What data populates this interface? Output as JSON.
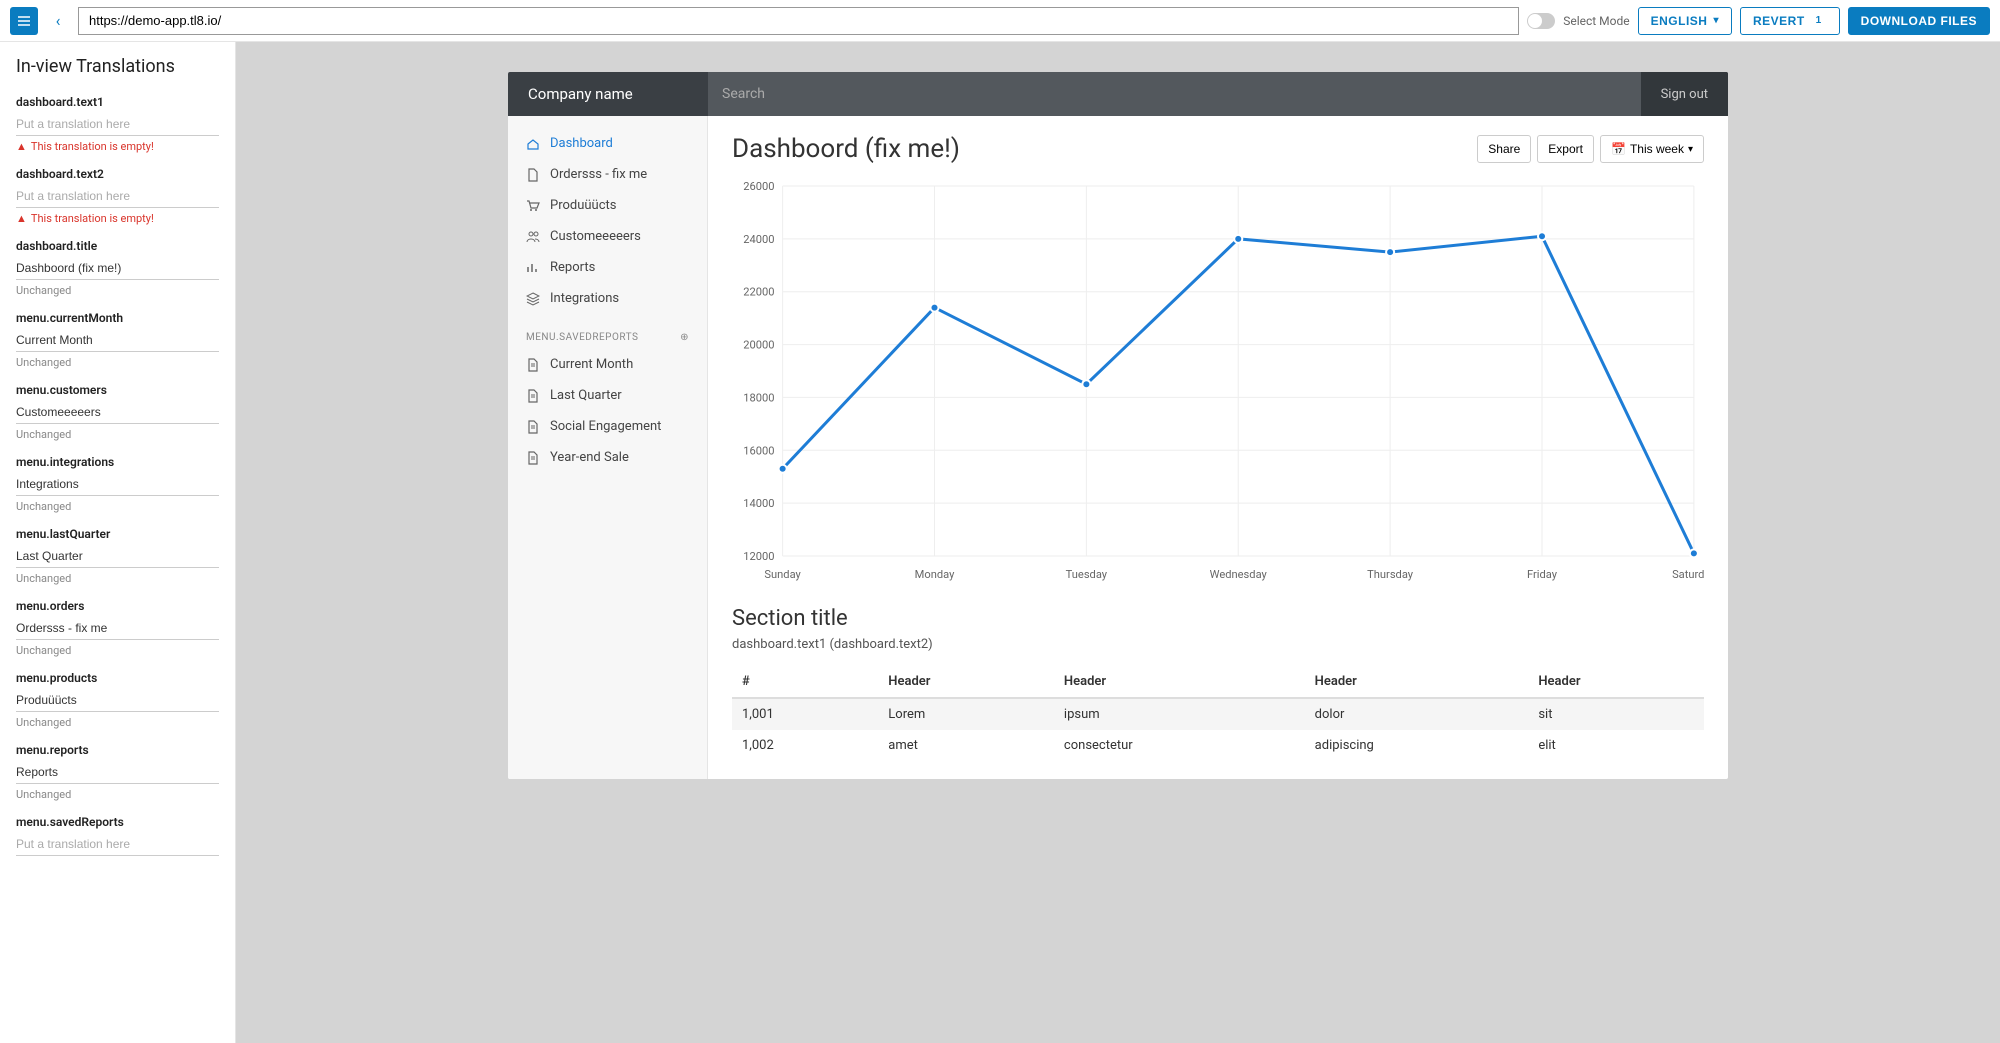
{
  "toolbar": {
    "url": "https://demo-app.tl8.io/",
    "select_mode_label": "Select Mode",
    "language_label": "ENGLISH",
    "revert_label": "REVERT",
    "revert_count": "1",
    "download_label": "DOWNLOAD FILES"
  },
  "sidebar": {
    "title": "In-view Translations",
    "placeholder_text": "Put a translation here",
    "error_text": "This translation is empty!",
    "unchanged_text": "Unchanged",
    "items": [
      {
        "key": "dashboard.text1",
        "value": "",
        "status": "error"
      },
      {
        "key": "dashboard.text2",
        "value": "",
        "status": "error"
      },
      {
        "key": "dashboard.title",
        "value": "Dashboord (fix me!)",
        "status": "unchanged"
      },
      {
        "key": "menu.currentMonth",
        "value": "Current Month",
        "status": "unchanged"
      },
      {
        "key": "menu.customers",
        "value": "Customeeeeers",
        "status": "unchanged"
      },
      {
        "key": "menu.integrations",
        "value": "Integrations",
        "status": "unchanged"
      },
      {
        "key": "menu.lastQuarter",
        "value": "Last Quarter",
        "status": "unchanged"
      },
      {
        "key": "menu.orders",
        "value": "Ordersss - fix me",
        "status": "unchanged"
      },
      {
        "key": "menu.products",
        "value": "Produüücts",
        "status": "unchanged"
      },
      {
        "key": "menu.reports",
        "value": "Reports",
        "status": "unchanged"
      },
      {
        "key": "menu.savedReports",
        "value": "",
        "status": "none"
      }
    ]
  },
  "app": {
    "company": "Company name",
    "search_placeholder": "Search",
    "sign_out": "Sign out",
    "nav": [
      {
        "label": "Dashboard",
        "icon": "home",
        "active": true
      },
      {
        "label": "Ordersss - fix me",
        "icon": "file"
      },
      {
        "label": "Produüücts",
        "icon": "cart"
      },
      {
        "label": "Customeeeeers",
        "icon": "users"
      },
      {
        "label": "Reports",
        "icon": "bars"
      },
      {
        "label": "Integrations",
        "icon": "layers"
      }
    ],
    "saved_reports_label": "MENU.SAVEDREPORTS",
    "saved_reports": [
      {
        "label": "Current Month"
      },
      {
        "label": "Last Quarter"
      },
      {
        "label": "Social Engagement"
      },
      {
        "label": "Year-end Sale"
      }
    ],
    "page_title": "Dashboord (fix me!)",
    "share_label": "Share",
    "export_label": "Export",
    "this_week_label": "This week",
    "section_title": "Section title",
    "section_sub": "dashboard.text1 (dashboard.text2)",
    "table": {
      "headers": [
        "#",
        "Header",
        "Header",
        "Header",
        "Header"
      ],
      "rows": [
        [
          "1,001",
          "Lorem",
          "ipsum",
          "dolor",
          "sit"
        ],
        [
          "1,002",
          "amet",
          "consectetur",
          "adipiscing",
          "elit"
        ]
      ]
    }
  },
  "chart_data": {
    "type": "line",
    "categories": [
      "Sunday",
      "Monday",
      "Tuesday",
      "Wednesday",
      "Thursday",
      "Friday",
      "Saturday"
    ],
    "values": [
      15300,
      21400,
      18500,
      24000,
      23500,
      24100,
      12100
    ],
    "ylim": [
      12000,
      26000
    ],
    "ytick_step": 2000,
    "xlabel": "",
    "ylabel": "",
    "title": ""
  }
}
